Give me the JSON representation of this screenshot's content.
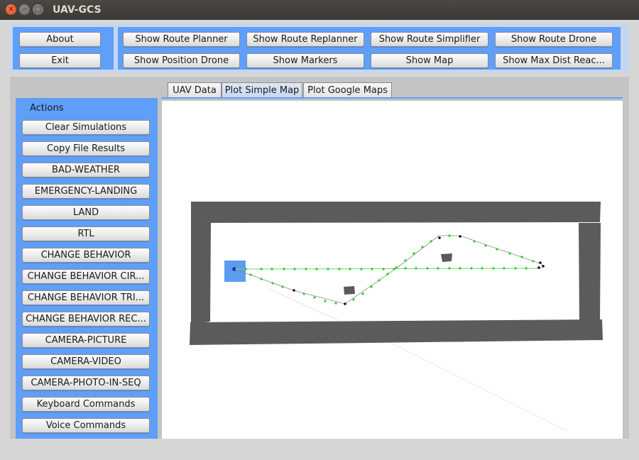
{
  "window": {
    "title": "UAV-GCS"
  },
  "top_buttons_left": [
    "About",
    "Exit"
  ],
  "top_buttons_right": [
    "Show Route Planner",
    "Show Route Replanner",
    "Show Route Simplifier",
    "Show Route Drone",
    "Show Position Drone",
    "Show Markers",
    "Show Map",
    "Show Max Dist Reac..."
  ],
  "tabs": [
    "UAV Data",
    "Plot Simple Map",
    "Plot Google Maps"
  ],
  "active_tab": "Plot Simple Map",
  "sidebar": {
    "title": "Actions",
    "buttons": [
      "Clear Simulations",
      "Copy File Results",
      "BAD-WEATHER",
      "EMERGENCY-LANDING",
      "LAND",
      "RTL",
      "CHANGE BEHAVIOR",
      "CHANGE BEHAVIOR CIR...",
      "CHANGE BEHAVIOR TRI...",
      "CHANGE BEHAVIOR REC...",
      "CAMERA-PICTURE",
      "CAMERA-VIDEO",
      "CAMERA-PHOTO-IN-SEQ",
      "Keyboard Commands",
      "Voice Commands"
    ]
  },
  "colors": {
    "panel_blue": "#5f9ffa",
    "wall_gray": "#5b5b5b",
    "route_green": "#22d022",
    "waypoint_black": "#111111",
    "drone_square": "#5b9cf0",
    "drone_dot": "#1010d0"
  }
}
